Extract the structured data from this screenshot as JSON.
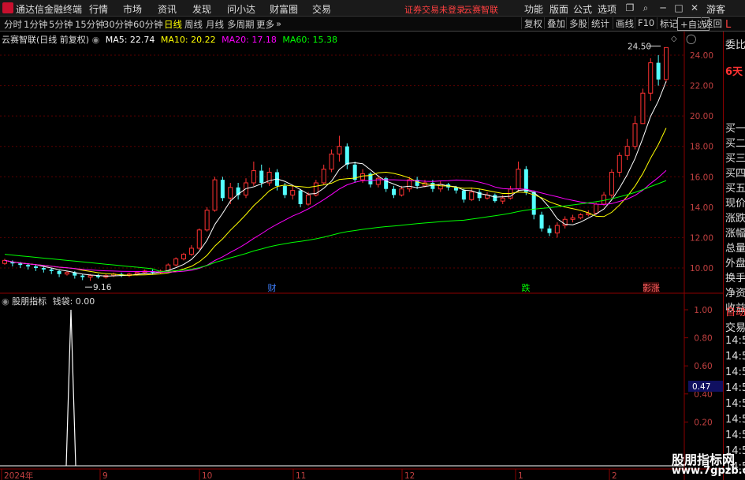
{
  "menubar": {
    "app_name": "通达信金融终端",
    "items": [
      "行情",
      "市场",
      "资讯",
      "发现",
      "问小达",
      "财富圈",
      "交易"
    ],
    "notice_left": "证券交易未登录",
    "notice_right": "云赛智联",
    "right_items": [
      "功能",
      "版面",
      "公式",
      "选项"
    ],
    "guest": "游客"
  },
  "toolbar": {
    "periods": [
      "分时",
      "1分钟",
      "5分钟",
      "15分钟",
      "30分钟",
      "60分钟",
      "日线",
      "周线",
      "月线",
      "多周期",
      "更多"
    ],
    "active_period": "日线",
    "tools": [
      "复权",
      "叠加",
      "多股",
      "统计",
      "画线",
      "F10",
      "标记",
      "+自选",
      "返回"
    ]
  },
  "main": {
    "stock_label": "云赛智联(日线 前复权)",
    "ma": [
      {
        "name": "MA5",
        "value": "22.74",
        "color": "#ffffff"
      },
      {
        "name": "MA10",
        "value": "20.22",
        "color": "#ffff00"
      },
      {
        "name": "MA20",
        "value": "17.18",
        "color": "#ff00ff"
      },
      {
        "name": "MA60",
        "value": "15.38",
        "color": "#00ff00"
      }
    ],
    "price_axis": [
      "24.00",
      "22.00",
      "20.00",
      "18.00",
      "16.00",
      "14.00",
      "12.00",
      "10.00"
    ],
    "high_marker": "24.50",
    "low_marker": "9.16",
    "event_tags": [
      {
        "text": "财",
        "color": "#4080ff"
      },
      {
        "text": "跌",
        "color": "#00ff00"
      },
      {
        "text": "影涨",
        "color": "#ff6060"
      }
    ]
  },
  "sub": {
    "indicator_name": "股朋指标",
    "indicator_value_label": "钱袋: 0.00",
    "axis": [
      "1.00",
      "0.80",
      "0.60",
      "0.40",
      "0.20"
    ],
    "current_value": "0.47"
  },
  "time_axis": [
    "2024年",
    "9",
    "10",
    "11",
    "12",
    "1",
    "2"
  ],
  "side": {
    "top_letter": "L",
    "items": [
      "委比",
      "6天",
      "买一",
      "买二",
      "买三",
      "买四",
      "买五",
      "现价",
      "涨跌",
      "涨幅",
      "总量",
      "外盘",
      "换手",
      "净资",
      "收益",
      "自动",
      "交易",
      "14:5",
      "14:5",
      "14:5",
      "14:5",
      "14:5",
      "14:5",
      "14:5",
      "14:5",
      "14:5"
    ]
  },
  "watermark": {
    "line1": "股朋指标网",
    "line2": "www.7gpzb.com"
  },
  "chart_data": {
    "type": "candlestick",
    "title": "云赛智联(日线 前复权)",
    "ylim": [
      9,
      25
    ],
    "candles": [
      [
        10.3,
        10.5,
        10.2,
        10.6
      ],
      [
        10.4,
        10.3,
        10.1,
        10.5
      ],
      [
        10.3,
        10.2,
        10.0,
        10.4
      ],
      [
        10.2,
        10.1,
        9.9,
        10.3
      ],
      [
        10.1,
        10.0,
        9.8,
        10.2
      ],
      [
        10.0,
        9.9,
        9.7,
        10.1
      ],
      [
        9.9,
        9.8,
        9.6,
        10.0
      ],
      [
        9.8,
        9.6,
        9.4,
        9.9
      ],
      [
        9.6,
        9.7,
        9.5,
        9.8
      ],
      [
        9.7,
        9.5,
        9.3,
        9.8
      ],
      [
        9.5,
        9.4,
        9.2,
        9.6
      ],
      [
        9.4,
        9.5,
        9.16,
        9.6
      ],
      [
        9.5,
        9.4,
        9.3,
        9.6
      ],
      [
        9.4,
        9.5,
        9.3,
        9.6
      ],
      [
        9.5,
        9.6,
        9.4,
        9.7
      ],
      [
        9.6,
        9.5,
        9.4,
        9.7
      ],
      [
        9.5,
        9.6,
        9.4,
        9.7
      ],
      [
        9.6,
        9.7,
        9.5,
        9.8
      ],
      [
        9.7,
        9.8,
        9.6,
        9.9
      ],
      [
        9.8,
        9.7,
        9.6,
        9.9
      ],
      [
        9.7,
        9.8,
        9.6,
        9.9
      ],
      [
        9.8,
        10.2,
        9.7,
        10.3
      ],
      [
        10.2,
        10.6,
        10.1,
        10.7
      ],
      [
        10.6,
        10.9,
        10.5,
        11.0
      ],
      [
        10.9,
        11.3,
        10.8,
        11.5
      ],
      [
        11.3,
        12.5,
        11.2,
        12.6
      ],
      [
        12.5,
        13.8,
        12.4,
        14.0
      ],
      [
        13.8,
        15.8,
        13.7,
        16.0
      ],
      [
        15.8,
        14.6,
        14.4,
        16.0
      ],
      [
        14.6,
        15.3,
        14.2,
        15.6
      ],
      [
        15.3,
        14.8,
        14.5,
        15.6
      ],
      [
        14.8,
        15.6,
        14.6,
        15.9
      ],
      [
        15.6,
        16.4,
        15.4,
        17.0
      ],
      [
        16.4,
        15.6,
        15.3,
        16.8
      ],
      [
        15.6,
        16.3,
        15.4,
        16.6
      ],
      [
        16.3,
        15.4,
        15.1,
        16.5
      ],
      [
        15.4,
        14.8,
        14.6,
        15.6
      ],
      [
        14.8,
        15.1,
        14.5,
        15.4
      ],
      [
        15.1,
        14.2,
        14.0,
        15.2
      ],
      [
        14.2,
        14.8,
        14.1,
        15.0
      ],
      [
        14.8,
        15.6,
        14.7,
        15.8
      ],
      [
        15.6,
        16.5,
        15.5,
        16.8
      ],
      [
        16.5,
        17.5,
        16.3,
        17.8
      ],
      [
        17.5,
        18.0,
        17.0,
        18.7
      ],
      [
        18.0,
        16.8,
        16.5,
        18.2
      ],
      [
        16.8,
        15.8,
        15.6,
        17.0
      ],
      [
        15.8,
        16.2,
        15.6,
        16.5
      ],
      [
        16.2,
        15.5,
        15.3,
        16.3
      ],
      [
        15.5,
        15.9,
        15.3,
        16.1
      ],
      [
        15.9,
        15.2,
        15.0,
        16.0
      ],
      [
        15.2,
        14.8,
        14.6,
        15.4
      ],
      [
        14.8,
        15.2,
        14.7,
        15.4
      ],
      [
        15.2,
        15.8,
        15.0,
        16.0
      ],
      [
        15.8,
        15.4,
        15.2,
        16.0
      ],
      [
        15.4,
        15.6,
        15.3,
        15.8
      ],
      [
        15.6,
        15.2,
        15.0,
        15.8
      ],
      [
        15.2,
        15.5,
        15.0,
        15.7
      ],
      [
        15.5,
        15.3,
        15.1,
        15.6
      ],
      [
        15.3,
        15.1,
        14.9,
        15.4
      ],
      [
        15.1,
        14.5,
        14.3,
        15.2
      ],
      [
        14.5,
        15.0,
        14.4,
        15.3
      ],
      [
        15.0,
        14.6,
        14.4,
        15.2
      ],
      [
        14.6,
        14.8,
        14.5,
        15.0
      ],
      [
        14.8,
        14.4,
        14.3,
        14.9
      ],
      [
        14.4,
        14.6,
        14.2,
        14.8
      ],
      [
        14.6,
        15.2,
        14.5,
        15.4
      ],
      [
        15.2,
        16.5,
        15.0,
        17.0
      ],
      [
        16.5,
        15.0,
        14.8,
        16.7
      ],
      [
        15.0,
        13.5,
        13.2,
        15.1
      ],
      [
        13.5,
        12.6,
        12.4,
        13.7
      ],
      [
        12.6,
        12.3,
        12.1,
        12.8
      ],
      [
        12.3,
        12.8,
        12.0,
        13.0
      ],
      [
        12.8,
        13.2,
        12.6,
        13.4
      ],
      [
        13.2,
        13.3,
        13.0,
        13.5
      ],
      [
        13.3,
        13.5,
        13.2,
        13.6
      ],
      [
        13.5,
        13.6,
        13.4,
        13.8
      ],
      [
        13.6,
        14.2,
        13.5,
        14.3
      ],
      [
        14.2,
        14.8,
        14.1,
        15.0
      ],
      [
        14.8,
        16.3,
        14.6,
        16.5
      ],
      [
        16.3,
        17.4,
        16.0,
        17.6
      ],
      [
        17.4,
        18.0,
        17.1,
        18.5
      ],
      [
        18.0,
        19.5,
        17.8,
        20.0
      ],
      [
        19.5,
        21.5,
        20.0,
        21.8
      ],
      [
        21.5,
        23.5,
        21.0,
        23.8
      ],
      [
        23.5,
        22.4,
        22.0,
        24.0
      ],
      [
        22.4,
        24.5,
        22.2,
        24.5
      ]
    ],
    "ma_series": [
      "MA5",
      "MA10",
      "MA20",
      "MA60"
    ],
    "sub_indicator": {
      "name": "钱袋",
      "spike_value": 1.0
    }
  }
}
